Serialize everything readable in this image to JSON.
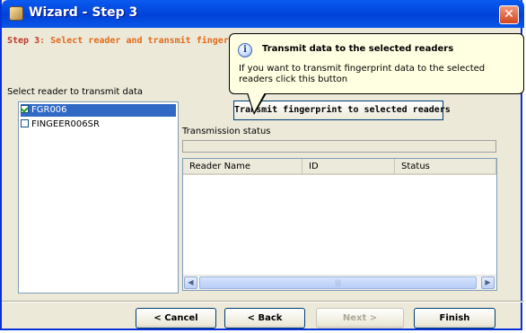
{
  "window": {
    "title": "Wizard - Step 3",
    "close_glyph": "✕"
  },
  "step": {
    "prefix": "Step 3",
    "text": ": Select reader and transmit fingerprint"
  },
  "reader_list": {
    "label": "Select reader to transmit data",
    "items": [
      {
        "name": "FGR006",
        "checked": true,
        "selected": true
      },
      {
        "name": "FINGEER006SR",
        "checked": false,
        "selected": false
      }
    ]
  },
  "transmit_button": {
    "label": "Transmit fingerprint to selected readers"
  },
  "tooltip": {
    "icon": "info-icon",
    "title": "Transmit data to the selected readers",
    "body": "If you want to transmit fingerprint data to the selected readers click this button"
  },
  "transmission": {
    "label": "Transmission status",
    "columns": [
      "Reader Name",
      "ID",
      "Status"
    ],
    "rows": []
  },
  "buttons": {
    "cancel": "< Cancel",
    "back": "< Back",
    "next": "Next >",
    "finish": "Finish"
  },
  "colors": {
    "titlebar": "#0054e3",
    "step_text": "#e06b1d",
    "selection": "#316ac5",
    "tooltip_bg": "#ffffe1"
  }
}
